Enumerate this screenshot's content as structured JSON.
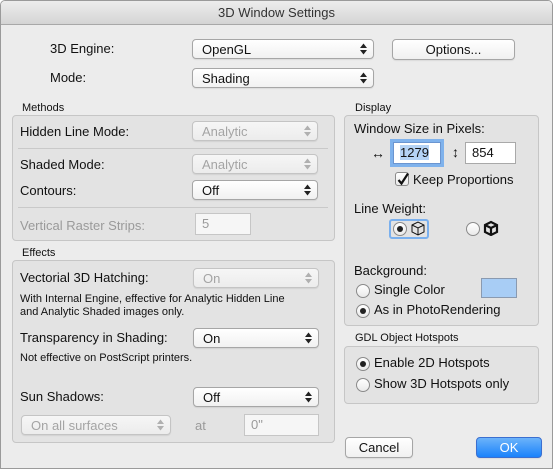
{
  "window": {
    "title": "3D Window Settings"
  },
  "engine": {
    "label": "3D Engine:",
    "value": "OpenGL",
    "options_button": "Options..."
  },
  "mode": {
    "label": "Mode:",
    "value": "Shading"
  },
  "methods": {
    "header": "Methods",
    "hidden_line_label": "Hidden Line Mode:",
    "hidden_line_value": "Analytic",
    "shaded_label": "Shaded Mode:",
    "shaded_value": "Analytic",
    "contours_label": "Contours:",
    "contours_value": "Off",
    "raster_label": "Vertical Raster Strips:",
    "raster_value": "5"
  },
  "effects": {
    "header": "Effects",
    "hatching_label": "Vectorial 3D Hatching:",
    "hatching_value": "On",
    "hatching_note_1": "With Internal Engine, effective for Analytic Hidden Line",
    "hatching_note_2": "and Analytic Shaded images only.",
    "transparency_label": "Transparency in Shading:",
    "transparency_value": "On",
    "transparency_note": "Not effective on PostScript printers.",
    "shadows_label": "Sun Shadows:",
    "shadows_value": "Off",
    "surfaces_value": "On all surfaces",
    "at_label": "at",
    "at_value": "0\""
  },
  "display": {
    "header": "Display",
    "window_size_label": "Window Size in Pixels:",
    "width_icon": "↔",
    "width_value": "1279",
    "height_icon": "↕",
    "height_value": "854",
    "keep_proportions_label": "Keep Proportions",
    "keep_proportions_checked": true,
    "line_weight_label": "Line Weight:",
    "line_weight_option1": "uniform-line-icon",
    "line_weight_option2": "bold-line-icon",
    "background_label": "Background:",
    "single_color_label": "Single Color",
    "single_color_swatch": "#a8cdf5",
    "photorendering_label": "As in PhotoRendering"
  },
  "gdl": {
    "header": "GDL Object Hotspots",
    "enable_2d_label": "Enable 2D Hotspots",
    "show_3d_label": "Show 3D Hotspots only"
  },
  "footer": {
    "cancel_label": "Cancel",
    "ok_label": "OK"
  }
}
